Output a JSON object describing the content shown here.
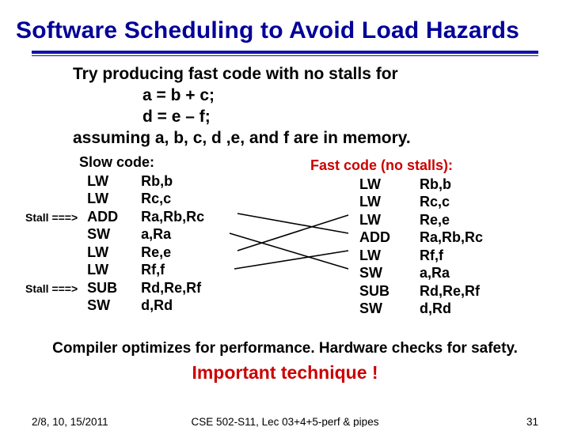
{
  "title": "Software Scheduling to Avoid Load Hazards",
  "intro": {
    "line1": "Try producing fast code with no stalls for",
    "line2": "a = b + c;",
    "line3": "d = e – f;",
    "line4": "assuming a, b, c, d ,e, and f are in memory."
  },
  "slow": {
    "heading": "Slow code:",
    "stall_label": "Stall ===>",
    "rows": [
      {
        "stall": "",
        "op": "LW",
        "args": "Rb,b"
      },
      {
        "stall": "",
        "op": "LW",
        "args": "Rc,c"
      },
      {
        "stall": "Stall ===>",
        "op": "ADD",
        "args": "Ra,Rb,Rc"
      },
      {
        "stall": "",
        "op": "SW",
        "args": "a,Ra"
      },
      {
        "stall": "",
        "op": "LW",
        "args": "Re,e"
      },
      {
        "stall": "",
        "op": "LW",
        "args": "Rf,f"
      },
      {
        "stall": "Stall ===>",
        "op": "SUB",
        "args": "Rd,Re,Rf"
      },
      {
        "stall": "",
        "op": "SW",
        "args": "d,Rd"
      }
    ]
  },
  "fast": {
    "heading": "Fast code (no stalls):",
    "rows": [
      {
        "op": "LW",
        "args": "Rb,b"
      },
      {
        "op": "LW",
        "args": "Rc,c"
      },
      {
        "op": "LW",
        "args": "Re,e"
      },
      {
        "op": "ADD",
        "args": "Ra,Rb,Rc"
      },
      {
        "op": "LW",
        "args": "Rf,f"
      },
      {
        "op": "SW",
        "args": "a,Ra"
      },
      {
        "op": "SUB",
        "args": "Rd,Re,Rf"
      },
      {
        "op": "SW",
        "args": "d,Rd"
      }
    ]
  },
  "optimize_line": "Compiler optimizes for performance.  Hardware checks for safety.",
  "important": "Important technique !",
  "footer": {
    "date": "2/8, 10, 15/2011",
    "course": "CSE 502-S11, Lec 03+4+5-perf & pipes",
    "page": "31"
  }
}
